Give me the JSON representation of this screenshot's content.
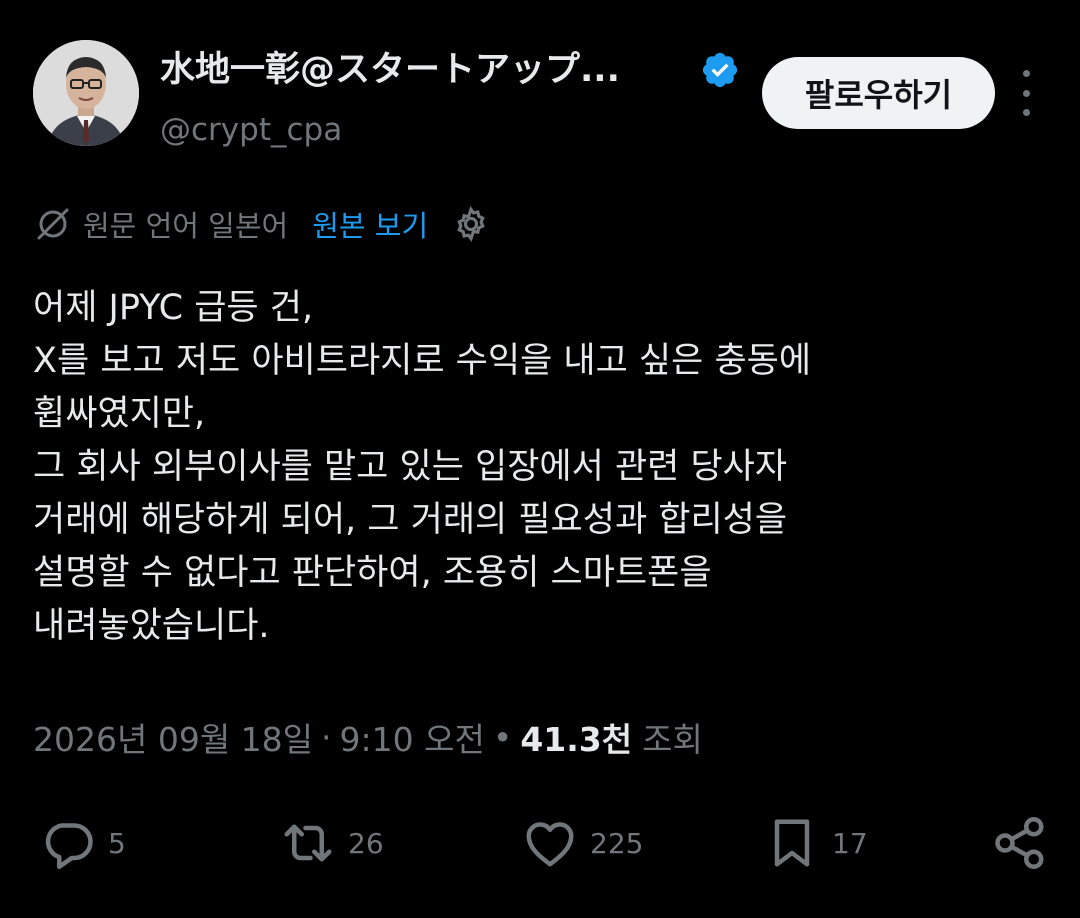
{
  "author": {
    "display_name": "水地一彰@スタートアップ...",
    "handle": "@crypt_cpa",
    "verified": true,
    "follow_label": "팔로우하기"
  },
  "translation": {
    "language_label": "원문 언어 일본어",
    "show_original_label": "원본 보기"
  },
  "tweet": {
    "lines": [
      "어제 JPYC 급등 건,",
      "X를 보고 저도 아비트라지로 수익을 내고 싶은 충동에",
      "휩싸였지만,",
      "그 회사 외부이사를 맡고 있는 입장에서 관련 당사자",
      "거래에 해당하게 되어, 그 거래의 필요성과 합리성을",
      "설명할 수 없다고 판단하여, 조용히 스마트폰을",
      "내려놓았습니다."
    ]
  },
  "meta": {
    "date": "2026년 09월 18일",
    "separator": "·",
    "time": "9:10 오전",
    "bullet": "•",
    "views_count": "41.3천",
    "views_label": "조회"
  },
  "actions": {
    "replies": "5",
    "reposts": "26",
    "likes": "225",
    "bookmarks": "17"
  },
  "icons": {
    "reply": "reply-bubble-icon",
    "repost": "repost-icon",
    "like": "heart-icon",
    "bookmark": "bookmark-icon",
    "share": "share-icon",
    "more": "more-vertical-icon",
    "translate": "translate-icon",
    "settings": "gear-icon",
    "verified": "verified-badge-icon"
  },
  "colors": {
    "background": "#000000",
    "text_primary": "#e7e9ea",
    "text_secondary": "#71767b",
    "accent": "#1d9bf0",
    "follow_button_bg": "#eff3f4"
  }
}
